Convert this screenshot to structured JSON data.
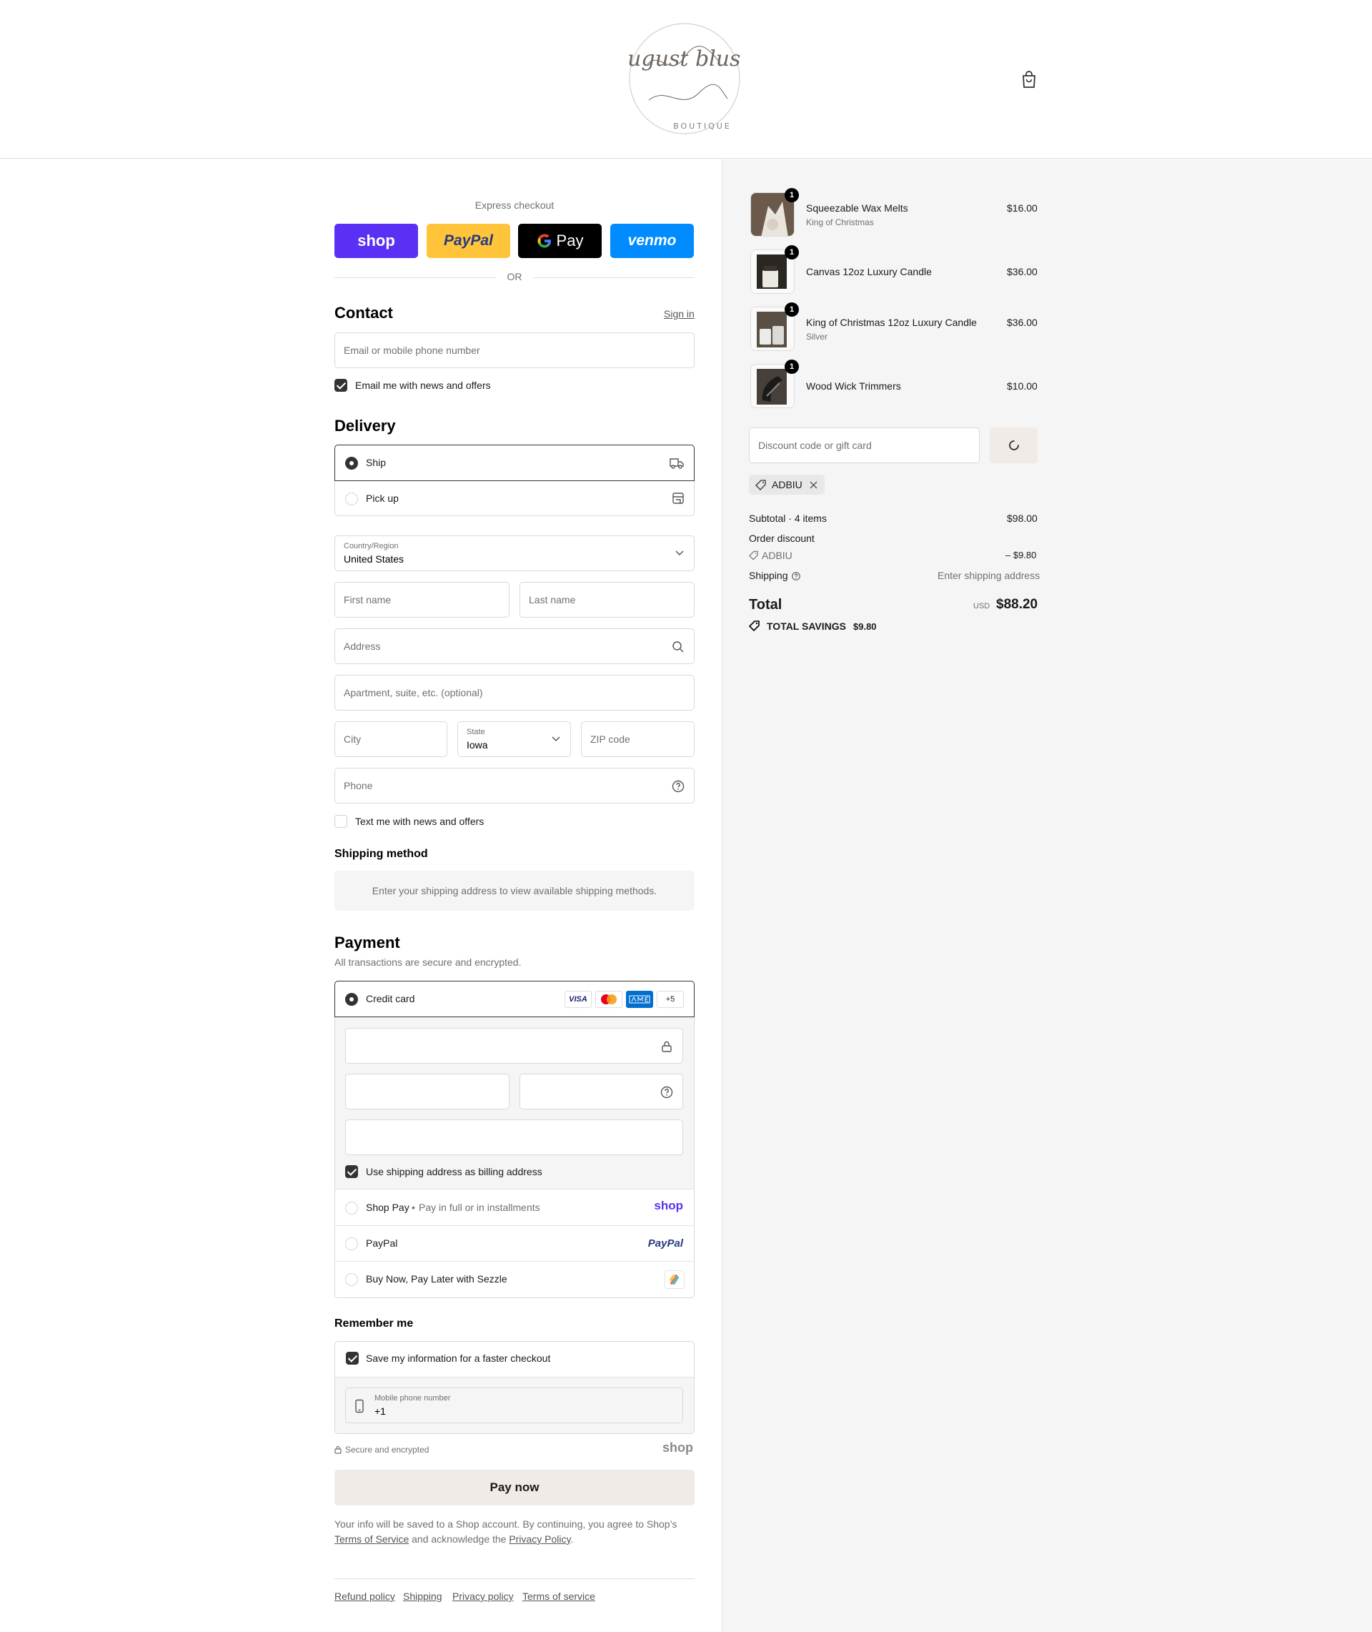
{
  "header": {
    "logo_script": "august blush",
    "logo_sub": "BOUTIQUE"
  },
  "express": {
    "label": "Express checkout",
    "shop_label": "shop",
    "paypal_label": "PayPal",
    "gpay_label": "Pay",
    "venmo_label": "venmo",
    "or_label": "OR"
  },
  "contact": {
    "title": "Contact",
    "sign_in": "Sign in",
    "email_placeholder": "Email or mobile phone number",
    "news_label": "Email me with news and offers"
  },
  "delivery": {
    "title": "Delivery",
    "ship_label": "Ship",
    "pickup_label": "Pick up",
    "country_label": "Country/Region",
    "country_value": "United States",
    "first_name": "First name",
    "last_name": "Last name",
    "address": "Address",
    "apartment": "Apartment, suite, etc. (optional)",
    "city": "City",
    "state_label": "State",
    "state_value": "Iowa",
    "zip": "ZIP code",
    "phone": "Phone",
    "text_label": "Text me with news and offers"
  },
  "shipping_method": {
    "title": "Shipping method",
    "message": "Enter your shipping address to view available shipping methods."
  },
  "payment": {
    "title": "Payment",
    "subtitle": "All transactions are secure and encrypted.",
    "credit_card": "Credit card",
    "more_cards": "+5",
    "visa": "VISA",
    "billing_label": "Use shipping address as billing address",
    "shop_pay": "Shop Pay",
    "shop_pay_sub": "Pay in full or in installments",
    "shop_logo": "shop",
    "paypal": "PayPal",
    "paypal_logo": "PayPal",
    "sezzle": "Buy Now, Pay Later with Sezzle"
  },
  "remember": {
    "title": "Remember me",
    "save_label": "Save my information for a faster checkout",
    "mobile_label": "Mobile phone number",
    "mobile_value": "+1",
    "secure": "Secure and encrypted",
    "shop_logo": "shop"
  },
  "pay_now": "Pay now",
  "disclaimer": {
    "part1": "Your info will be saved to a Shop account. By continuing, you agree to Shop’s",
    "terms": "Terms of Service",
    "part2": "and acknowledge the",
    "privacy": "Privacy Policy",
    "end": "."
  },
  "footer": {
    "links": [
      "Refund policy",
      "Shipping",
      "Privacy policy",
      "Terms of service"
    ]
  },
  "summary": {
    "items": [
      {
        "name": "Squeezable Wax Melts",
        "variant": "King of Christmas",
        "price": "$16.00",
        "qty": "1"
      },
      {
        "name": "Canvas 12oz Luxury Candle",
        "variant": "",
        "price": "$36.00",
        "qty": "1"
      },
      {
        "name": "King of Christmas 12oz Luxury Candle",
        "variant": "Silver",
        "price": "$36.00",
        "qty": "1"
      },
      {
        "name": "Wood Wick Trimmers",
        "variant": "",
        "price": "$10.00",
        "qty": "1"
      }
    ],
    "discount_placeholder": "Discount code or gift card",
    "applied_code": "ADBIU",
    "subtotal_label": "Subtotal · 4 items",
    "subtotal_value": "$98.00",
    "order_discount_label": "Order discount",
    "discount_code": "ADBIU",
    "discount_value": "– $9.80",
    "shipping_label": "Shipping",
    "shipping_value": "Enter shipping address",
    "total_label": "Total",
    "currency": "USD",
    "total_value": "$88.20",
    "savings_label": "TOTAL SAVINGS",
    "savings_value": "$9.80"
  },
  "colors": {
    "shop_purple": "#5a31f4",
    "paypal_yellow": "#ffc439",
    "venmo_blue": "#3d95ce",
    "summary_bg": "#f5f5f5"
  }
}
